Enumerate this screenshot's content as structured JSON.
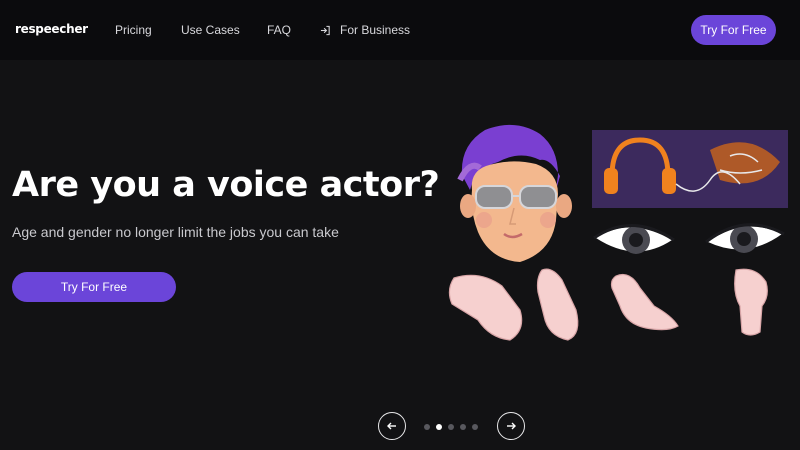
{
  "nav": {
    "logo": "respeecher",
    "links": [
      "Pricing",
      "Use Cases",
      "FAQ"
    ],
    "business_label": "For Business",
    "business_icon": "sign-in-icon",
    "cta_label": "Try For Free"
  },
  "hero": {
    "title": "Are you a voice actor?",
    "subtitle": "Age and gender no longer limit the jobs you can take",
    "cta_label": "Try For Free"
  },
  "carousel": {
    "prev_icon": "arrow-left-icon",
    "next_icon": "arrow-right-icon",
    "slide_count": 5,
    "active_index": 1
  },
  "colors": {
    "accent": "#6b45d9",
    "background": "#121214",
    "nav_background": "#0b0b0d"
  }
}
